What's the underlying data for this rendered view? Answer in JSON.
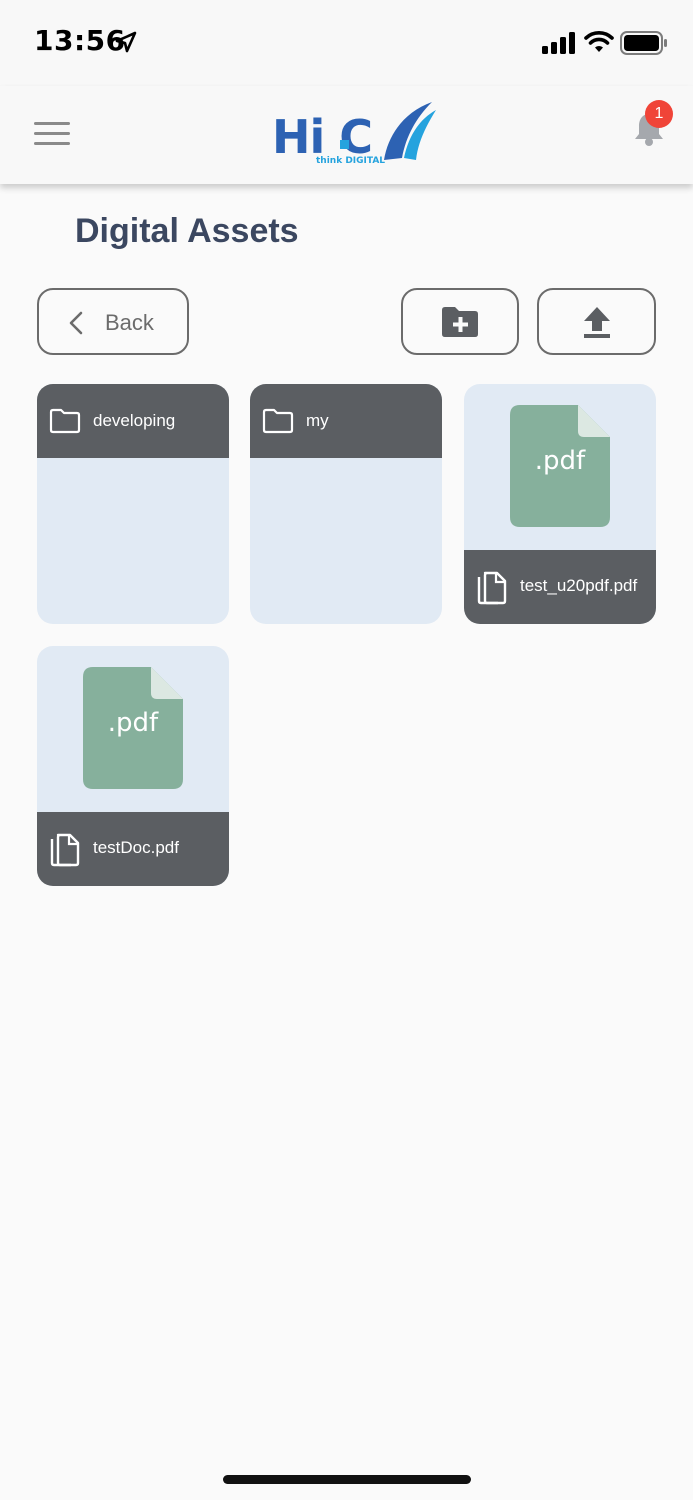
{
  "status_bar": {
    "time": "13:56"
  },
  "header": {
    "logo_text": "Hi C",
    "logo_subtitle": "think DIGITAL",
    "notification_count": "1",
    "brand_color": "#2d62b3",
    "accent_color": "#25a3de",
    "badge_color": "#f04438"
  },
  "page": {
    "title": "Digital Assets"
  },
  "toolbar": {
    "back_label": "Back",
    "new_folder_icon": "folder-plus-icon",
    "upload_icon": "upload-icon"
  },
  "items": [
    {
      "type": "folder",
      "name": "developing"
    },
    {
      "type": "folder",
      "name": "my"
    },
    {
      "type": "file",
      "name": "test_u20pdf.pdf",
      "thumb_label": ".pdf"
    },
    {
      "type": "file",
      "name": "testDoc.pdf",
      "thumb_label": ".pdf"
    }
  ],
  "colors": {
    "card_bg": "#e1eaf4",
    "card_bar": "#5b5e62",
    "pdf_thumb": "#86b09c",
    "title": "#3b4760"
  }
}
